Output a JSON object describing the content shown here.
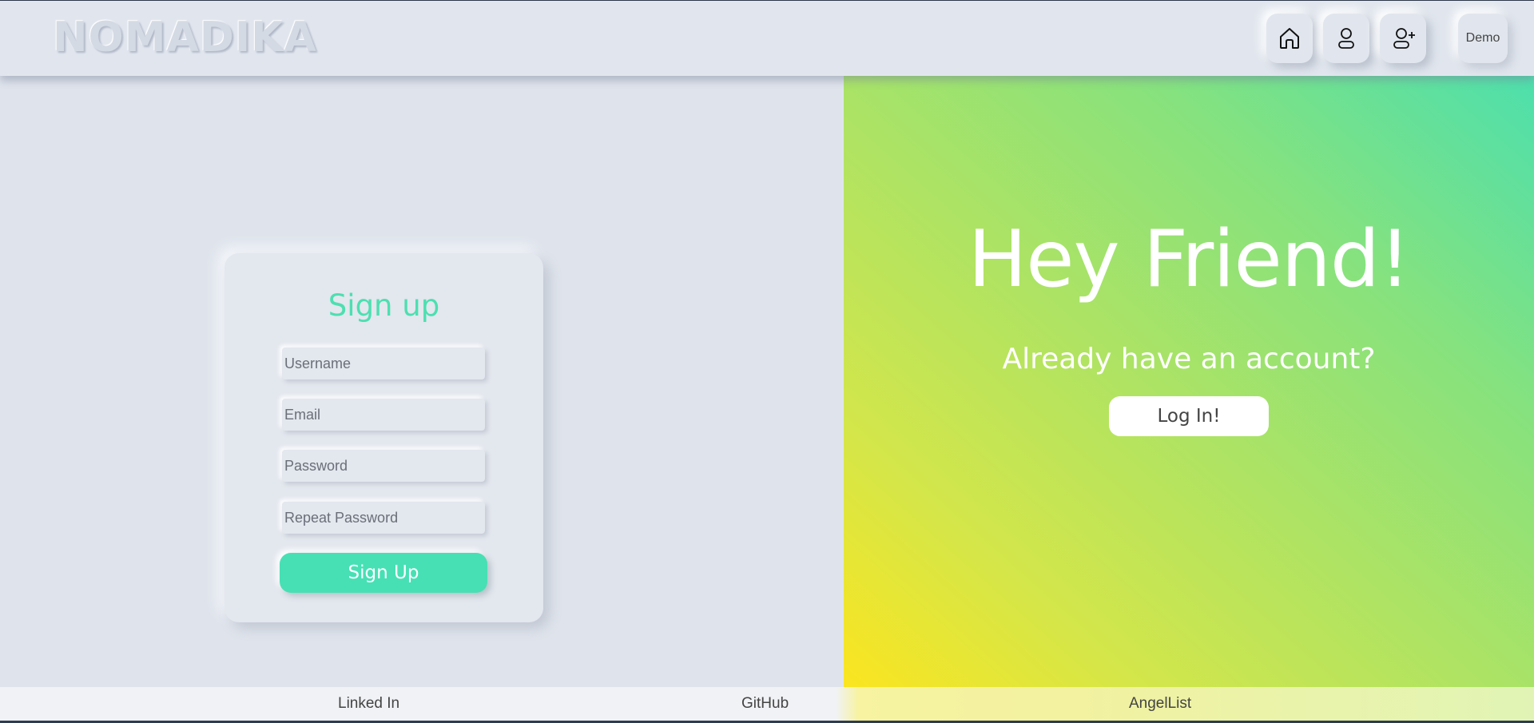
{
  "header": {
    "brand": "NOMADIKA",
    "nav": [
      {
        "icon": "home-icon"
      },
      {
        "icon": "user-icon"
      },
      {
        "icon": "add-user-icon"
      }
    ],
    "demo_label": "Demo"
  },
  "signup": {
    "title": "Sign up",
    "username_placeholder": "Username",
    "email_placeholder": "Email",
    "password_placeholder": "Password",
    "repeat_password_placeholder": "Repeat Password",
    "submit_label": "Sign Up",
    "accent_color": "#47e0b4"
  },
  "hero": {
    "title": "Hey Friend!",
    "subtitle": "Already have an account?",
    "login_label": "Log In!",
    "gradient_colors": [
      "#fbe51f",
      "#b0e362",
      "#4ddfad"
    ]
  },
  "footer": {
    "links": [
      "Linked In",
      "GitHub",
      "AngelList"
    ]
  }
}
